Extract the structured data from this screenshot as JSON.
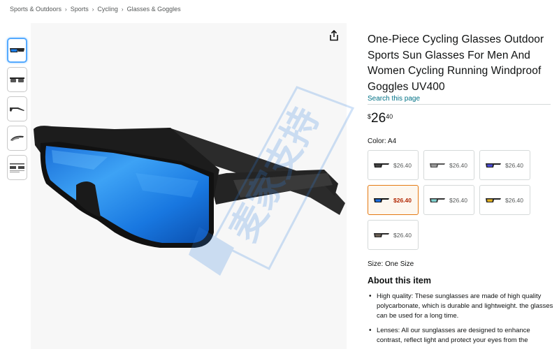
{
  "breadcrumb": [
    "Sports & Outdoors",
    "Sports",
    "Cycling",
    "Glasses & Goggles"
  ],
  "product": {
    "title": "One-Piece Cycling Glasses Outdoor Sports Sun Glasses For Men And Women Cycling Running Windproof Goggles UV400",
    "search_link": "Search this page",
    "price": {
      "symbol": "$",
      "whole": "26",
      "fraction": "40"
    }
  },
  "color": {
    "label": "Color: A4",
    "options": [
      {
        "price": "$26.40",
        "lens": "#444444",
        "selected": false
      },
      {
        "price": "$26.40",
        "lens": "#9a9a9a",
        "selected": false
      },
      {
        "price": "$26.40",
        "lens": "#4a4ad6",
        "selected": false
      },
      {
        "price": "$26.40",
        "lens": "#1e6fe0",
        "selected": true
      },
      {
        "price": "$26.40",
        "lens": "#7fd2cf",
        "selected": false
      },
      {
        "price": "$26.40",
        "lens": "#e0b020",
        "selected": false
      },
      {
        "price": "$26.40",
        "lens": "#6b6055",
        "selected": false
      }
    ]
  },
  "size": {
    "label": "Size: One Size"
  },
  "about": {
    "title": "About this item",
    "bullets": [
      "High quality: These sunglasses are made of high quality polycarbonate, which is durable and lightweight. the glasses can be used for a long time.",
      "Lenses: All our sunglasses are designed to enhance contrast, reflect light and protect your eyes from the"
    ]
  },
  "watermark": {
    "text": "麦家支持"
  },
  "colors": {
    "link": "#007185",
    "price_selected": "#b12704",
    "selected_border": "#e47911",
    "thumb_active": "#55aaff"
  }
}
